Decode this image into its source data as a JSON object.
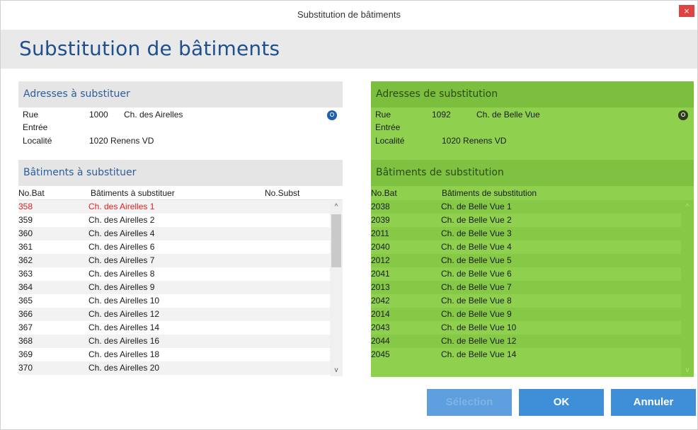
{
  "window": {
    "title": "Substitution de bâtiments",
    "close_symbol": "×"
  },
  "header": {
    "title": "Substitution de bâtiments"
  },
  "left": {
    "address_section_title": "Adresses à substituer",
    "address": {
      "rue_label": "Rue",
      "rue_number": "1000",
      "rue_name": "Ch. des Airelles",
      "entree_label": "Entrée",
      "localite_label": "Localité",
      "localite_value": "1020 Renens VD"
    },
    "buildings_section_title": "Bâtiments à substituer",
    "columns": {
      "nobat": "No.Bat",
      "name": "Bâtiments à substituer",
      "nosubst": "No.Subst"
    },
    "rows": [
      {
        "nobat": "358",
        "name": "Ch. des Airelles 1"
      },
      {
        "nobat": "359",
        "name": "Ch. des Airelles 2"
      },
      {
        "nobat": "360",
        "name": "Ch. des Airelles 4"
      },
      {
        "nobat": "361",
        "name": "Ch. des Airelles 6"
      },
      {
        "nobat": "362",
        "name": "Ch. des Airelles 7"
      },
      {
        "nobat": "363",
        "name": "Ch. des Airelles 8"
      },
      {
        "nobat": "364",
        "name": "Ch. des Airelles 9"
      },
      {
        "nobat": "365",
        "name": "Ch. des Airelles 10"
      },
      {
        "nobat": "366",
        "name": "Ch. des Airelles 12"
      },
      {
        "nobat": "367",
        "name": "Ch. des Airelles 14"
      },
      {
        "nobat": "368",
        "name": "Ch. des Airelles 16"
      },
      {
        "nobat": "369",
        "name": "Ch. des Airelles 18"
      },
      {
        "nobat": "370",
        "name": "Ch. des Airelles 20"
      }
    ],
    "selected_row": 0,
    "scroll_up": "^",
    "scroll_down": "v"
  },
  "right": {
    "address_section_title": "Adresses de substitution",
    "address": {
      "rue_label": "Rue",
      "rue_number": "1092",
      "rue_name": "Ch. de Belle Vue",
      "entree_label": "Entrée",
      "localite_label": "Localité",
      "localite_value": "1020 Renens VD"
    },
    "buildings_section_title": "Bâtiments de substitution",
    "columns": {
      "nobat": "No.Bat",
      "name": "Bâtiments de substitution"
    },
    "rows": [
      {
        "nobat": "2038",
        "name": "Ch. de Belle Vue 1"
      },
      {
        "nobat": "2039",
        "name": "Ch. de Belle Vue 2"
      },
      {
        "nobat": "2011",
        "name": "Ch. de Belle Vue 3"
      },
      {
        "nobat": "2040",
        "name": "Ch. de Belle Vue 4"
      },
      {
        "nobat": "2012",
        "name": "Ch. de Belle Vue 5"
      },
      {
        "nobat": "2041",
        "name": "Ch. de Belle Vue 6"
      },
      {
        "nobat": "2013",
        "name": "Ch. de Belle Vue 7"
      },
      {
        "nobat": "2042",
        "name": "Ch. de Belle Vue 8"
      },
      {
        "nobat": "2014",
        "name": "Ch. de Belle Vue 9"
      },
      {
        "nobat": "2043",
        "name": "Ch. de Belle Vue 10"
      },
      {
        "nobat": "2044",
        "name": "Ch. de Belle Vue 12"
      },
      {
        "nobat": "2045",
        "name": "Ch. de Belle Vue 14"
      }
    ],
    "scroll_up": "^",
    "scroll_down": "v"
  },
  "buttons": {
    "selection": "Sélection",
    "ok": "OK",
    "cancel": "Annuler"
  },
  "colors": {
    "accent": "#1e4f8e",
    "panel_green": "#8fd14f",
    "button_blue": "#3e8fd8",
    "selected_red": "#e02020"
  }
}
